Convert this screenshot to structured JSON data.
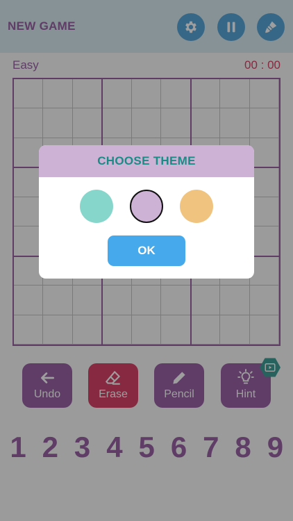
{
  "header": {
    "title": "NEW GAME",
    "buttons": [
      {
        "icon": "gear-icon"
      },
      {
        "icon": "pause-icon"
      },
      {
        "icon": "paint-brush-icon"
      }
    ]
  },
  "status": {
    "level": "Easy",
    "timer": "00 : 00"
  },
  "tools": [
    {
      "label": "Undo",
      "icon": "undo-arrow-icon",
      "color": "#9a63a7"
    },
    {
      "label": "Erase",
      "icon": "eraser-icon",
      "color": "#d9436a"
    },
    {
      "label": "Pencil",
      "icon": "pencil-icon",
      "color": "#9a63a7"
    },
    {
      "label": "Hint",
      "icon": "lightbulb-icon",
      "color": "#9a63a7"
    }
  ],
  "numbers": [
    "1",
    "2",
    "3",
    "4",
    "5",
    "6",
    "7",
    "8",
    "9"
  ],
  "dialog": {
    "title": "CHOOSE THEME",
    "themes": [
      {
        "color": "#87d6cc",
        "selected": false
      },
      {
        "color": "#cdb2d5",
        "selected": true
      },
      {
        "color": "#f0c37f",
        "selected": false
      }
    ],
    "ok_label": "OK"
  },
  "colors": {
    "accent": "#9a63a7",
    "timer": "#d9436a",
    "header_button": "#5aa7d9",
    "ok_button": "#45a9ec"
  }
}
